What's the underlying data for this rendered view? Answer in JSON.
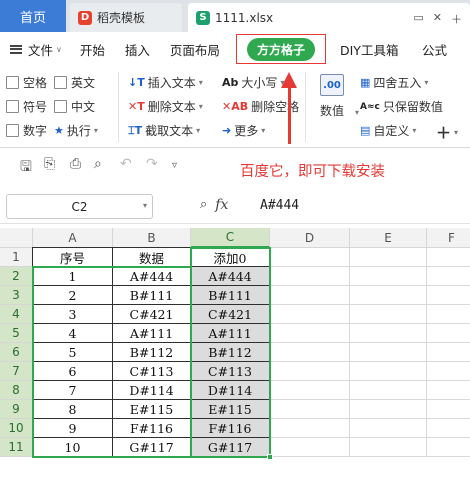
{
  "tabs": {
    "home": "首页",
    "template": "稻壳模板",
    "file": "1111.xlsx"
  },
  "ribbon": {
    "file_menu": "文件",
    "items": [
      "开始",
      "插入",
      "页面布局"
    ],
    "active": "方方格子",
    "items_after": [
      "DIY工具箱",
      "公式"
    ]
  },
  "toolbar": {
    "checkboxes": [
      "空格",
      "英文",
      "符号",
      "中文",
      "数字"
    ],
    "execute": "执行",
    "insert_text": "插入文本",
    "delete_text": "删除文本",
    "cut_text": "截取文本",
    "case": "大小写",
    "delete_space": "删除空格",
    "more": "更多",
    "number": "数值",
    "round": "四舍五入",
    "keep_value": "只保留数值",
    "custom": "自定义"
  },
  "annotation": "百度它，即可下载安装",
  "formula_bar": {
    "cell_ref": "C2",
    "fx": "fx",
    "formula": "A#444"
  },
  "sheet": {
    "columns": [
      "A",
      "B",
      "C",
      "D",
      "E",
      "F"
    ],
    "rows": [
      "1",
      "2",
      "3",
      "4",
      "5",
      "6",
      "7",
      "8",
      "9",
      "10",
      "11"
    ],
    "header": [
      "序号",
      "数据",
      "添加0"
    ],
    "data": [
      [
        "1",
        "A#444",
        "A#444"
      ],
      [
        "2",
        "B#111",
        "B#111"
      ],
      [
        "3",
        "C#421",
        "C#421"
      ],
      [
        "4",
        "A#111",
        "A#111"
      ],
      [
        "5",
        "B#112",
        "B#112"
      ],
      [
        "6",
        "C#113",
        "C#113"
      ],
      [
        "7",
        "D#114",
        "D#114"
      ],
      [
        "8",
        "E#115",
        "E#115"
      ],
      [
        "9",
        "F#116",
        "F#116"
      ],
      [
        "10",
        "G#117",
        "G#117"
      ]
    ]
  },
  "colors": {
    "accent_green": "#2fa84f",
    "annotation_red": "#e53935",
    "home_tab_blue": "#3c7bd6"
  }
}
